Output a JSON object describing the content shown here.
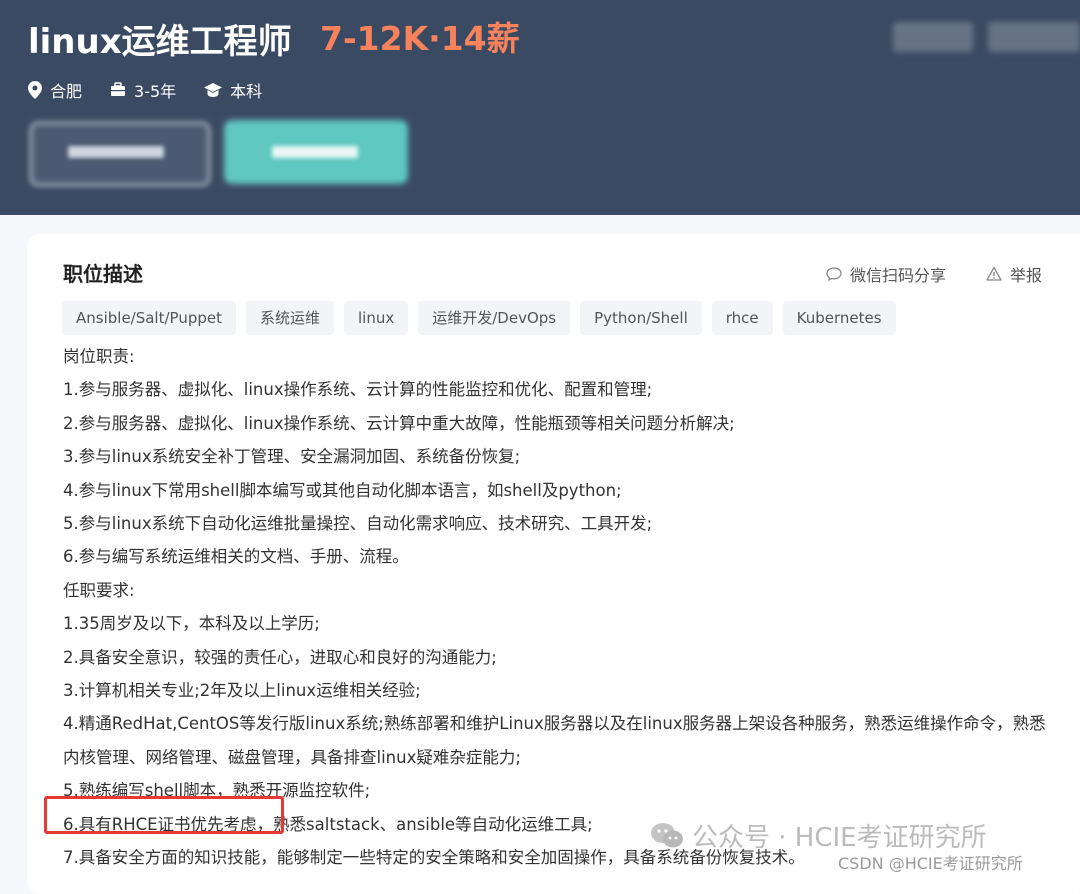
{
  "header": {
    "job_title": "linux运维工程师",
    "salary": "7-12K·14薪",
    "meta": {
      "location": "合肥",
      "experience": "3-5年",
      "education": "本科"
    },
    "colors": {
      "background": "#3b4a63",
      "salary": "#f7825c",
      "primary_button": "#5fc8c0"
    }
  },
  "card": {
    "section_title": "职位描述",
    "share_label": "微信扫码分享",
    "report_label": "举报",
    "tags": [
      "Ansible/Salt/Puppet",
      "系统运维",
      "linux",
      "运维开发/DevOps",
      "Python/Shell",
      "rhce",
      "Kubernetes"
    ],
    "lines": [
      "岗位职责:",
      "1.参与服务器、虚拟化、linux操作系统、云计算的性能监控和优化、配置和管理;",
      "2.参与服务器、虚拟化、linux操作系统、云计算中重大故障，性能瓶颈等相关问题分析解决;",
      "3.参与linux系统安全补丁管理、安全漏洞加固、系统备份恢复;",
      "4.参与linux下常用shell脚本编写或其他自动化脚本语言，如shell及python;",
      "5.参与linux系统下自动化运维批量操控、自动化需求响应、技术研究、工具开发;",
      "6.参与编写系统运维相关的文档、手册、流程。",
      "任职要求:",
      "1.35周岁及以下，本科及以上学历;",
      "2.具备安全意识，较强的责任心，进取心和良好的沟通能力;",
      "3.计算机相关专业;2年及以上linux运维相关经验;",
      "4.精通RedHat,CentOS等发行版linux系统;熟练部署和维护Linux服务器以及在linux服务器上架设各种服务，熟悉运维操作命令，熟悉内核管理、网络管理、磁盘管理，具备排查linux疑难杂症能力;",
      "5.熟练编写shell脚本，熟悉开源监控软件;",
      "6.具有RHCE证书优先考虑，熟悉saltstack、ansible等自动化运维工具;",
      "7.具备安全方面的知识技能，能够制定一些特定的安全策略和安全加固操作，具备系统备份恢复技术。"
    ]
  },
  "watermark": {
    "wechat": "公众号 · HCIE考证研究所",
    "csdn": "CSDN @HCIE考证研究所"
  }
}
